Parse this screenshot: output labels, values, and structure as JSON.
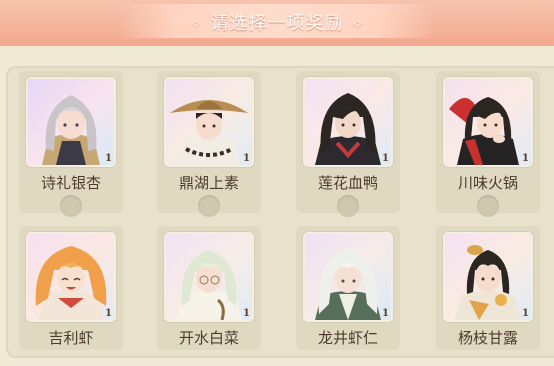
{
  "header": {
    "title": "请选择一项奖励",
    "sparkle": "✧"
  },
  "rewards": [
    {
      "name": "诗礼银杏",
      "quantity": "1",
      "icon": "character-portrait-silver-hair"
    },
    {
      "name": "鼎湖上素",
      "quantity": "1",
      "icon": "character-portrait-straw-hat"
    },
    {
      "name": "莲花血鸭",
      "quantity": "1",
      "icon": "character-portrait-dark-hair"
    },
    {
      "name": "川味火锅",
      "quantity": "1",
      "icon": "character-portrait-red-black"
    },
    {
      "name": "吉利虾",
      "quantity": "1",
      "icon": "character-portrait-orange-hair"
    },
    {
      "name": "开水白菜",
      "quantity": "1",
      "icon": "character-portrait-pale-green-hair"
    },
    {
      "name": "龙井虾仁",
      "quantity": "1",
      "icon": "character-portrait-white-hair"
    },
    {
      "name": "杨枝甘露",
      "quantity": "1",
      "icon": "character-portrait-dark-hair-gold"
    }
  ],
  "colors": {
    "banner": "#f3a98f",
    "panel": "#e8e2cd",
    "card": "#e0d9c2",
    "text": "#4e3b2c"
  }
}
